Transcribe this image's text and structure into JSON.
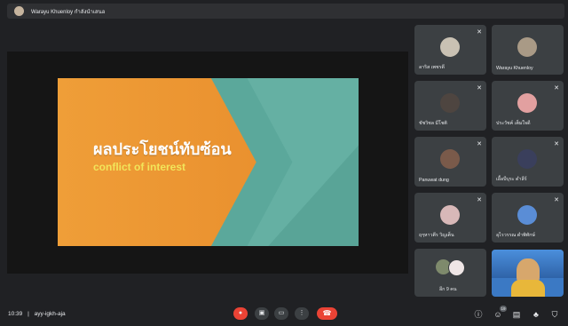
{
  "presenter_bar": {
    "label": "Warayu Khuenloy กำลังนำเสนอ"
  },
  "slide": {
    "title": "ผลประโยชน์ทับซ้อน",
    "subtitle": "conflict of interest"
  },
  "participants": [
    {
      "name": "อาริส เพชรดี",
      "muted": true,
      "avatar_color": "#c9c1b3"
    },
    {
      "name": "Warayu Khuenloy",
      "muted": false,
      "avatar_color": "#a99a86"
    },
    {
      "name": "ชัชวิชล มีโชติ",
      "muted": true,
      "avatar_color": "#4e4540"
    },
    {
      "name": "ประวัชค์ เต็มใจดี",
      "muted": true,
      "avatar_color": "#e2a0a0"
    },
    {
      "name": "Panuwat dung",
      "muted": true,
      "avatar_color": "#7a5a4a"
    },
    {
      "name": "เอื้อบีบุระ ดำลีร์",
      "muted": true,
      "avatar_color": "#3a3f5c"
    },
    {
      "name": "ฤๆหาวตีร วิญเต็น",
      "muted": true,
      "avatar_color": "#d8b8b8"
    },
    {
      "name": "อุไรวรรณ ดำพิทักษ์",
      "muted": true,
      "avatar_color": "#5a8dd6"
    }
  ],
  "more_participants": {
    "label": "อีก 9 คน"
  },
  "bottom_bar": {
    "time": "10:39",
    "separator": "|",
    "meeting_code": "ayy-igkh-aja",
    "people_count": "19"
  },
  "icons": {
    "mic_off": "mic-off-icon",
    "camera": "camera-icon",
    "present": "present-icon",
    "more": "more-vertical-icon",
    "end_call": "end-call-icon",
    "info": "info-icon",
    "people": "people-icon",
    "chat": "chat-icon",
    "activities": "activities-icon",
    "host_controls": "shield-icon"
  },
  "colors": {
    "background": "#202124",
    "tile": "#3c4043",
    "danger": "#ea4335"
  }
}
